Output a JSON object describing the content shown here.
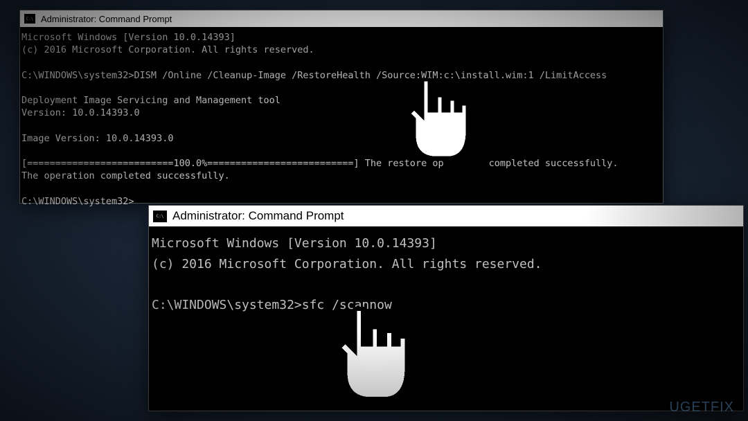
{
  "window1": {
    "title": "Administrator: Command Prompt",
    "lines": [
      "Microsoft Windows [Version 10.0.14393]",
      "(c) 2016 Microsoft Corporation. All rights reserved.",
      "",
      "C:\\WINDOWS\\system32>DISM /Online /Cleanup-Image /RestoreHealth /Source:WIM:c:\\install.wim:1 /LimitAccess",
      "",
      "Deployment Image Servicing and Management tool",
      "Version: 10.0.14393.0",
      "",
      "Image Version: 10.0.14393.0",
      "",
      "[==========================100.0%==========================] The restore op        completed successfully.",
      "The operation completed successfully.",
      "",
      "C:\\WINDOWS\\system32>"
    ]
  },
  "window2": {
    "title": "Administrator: Command Prompt",
    "lines": [
      "Microsoft Windows [Version 10.0.14393]",
      "(c) 2016 Microsoft Corporation. All rights reserved.",
      "",
      "C:\\WINDOWS\\system32>sfc /scannow"
    ]
  },
  "watermark": "UGETFIX"
}
